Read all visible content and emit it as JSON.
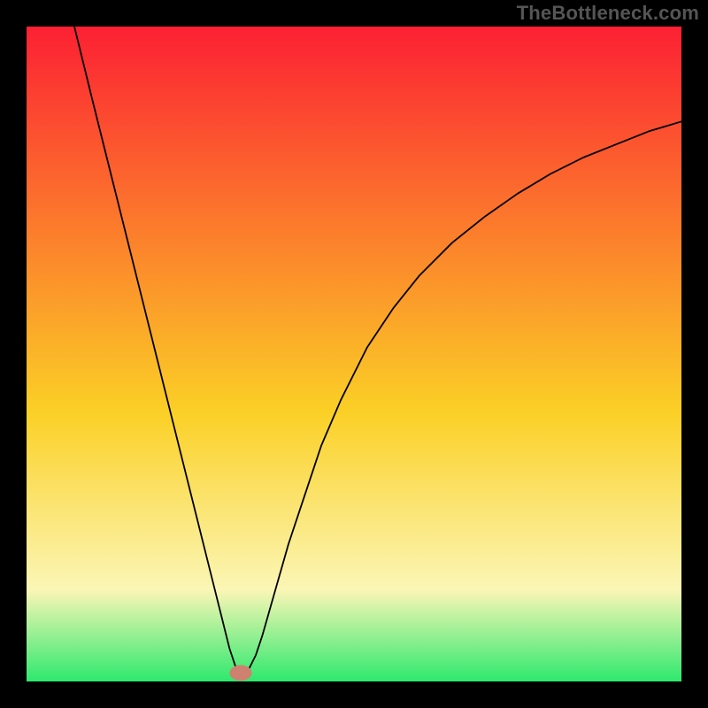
{
  "attribution": "TheBottleneck.com",
  "chart_data": {
    "type": "line",
    "title": "",
    "xlabel": "",
    "ylabel": "",
    "xlim": [
      0,
      100
    ],
    "ylim": [
      0,
      100
    ],
    "grid": false,
    "legend": false,
    "background_gradient": {
      "top": "#fc2033",
      "mid": "#fbd026",
      "low": "#fbf6b6",
      "bottom": "#2ee96e"
    },
    "series": [
      {
        "name": "bottleneck-curve",
        "type": "line",
        "color": "#000000",
        "x": [
          7.3,
          10,
          12,
          14,
          16,
          18,
          20,
          22,
          24,
          26,
          28,
          30,
          31,
          32,
          33,
          34,
          35,
          36,
          38,
          40,
          42,
          45,
          48,
          52,
          56,
          60,
          65,
          70,
          75,
          80,
          85,
          90,
          95,
          100
        ],
        "y": [
          100,
          89,
          81,
          73,
          65,
          57,
          49,
          41,
          33,
          25,
          17,
          9,
          5,
          2,
          1.5,
          2,
          4,
          7,
          14,
          21,
          27,
          36,
          43,
          51,
          57,
          62,
          67,
          71,
          74.5,
          77.5,
          80,
          82,
          84,
          85.5
        ]
      }
    ],
    "marker": {
      "x": 32.7,
      "y": 1.3,
      "rx": 1.7,
      "ry": 1.2,
      "fill": "#cf8170"
    }
  }
}
